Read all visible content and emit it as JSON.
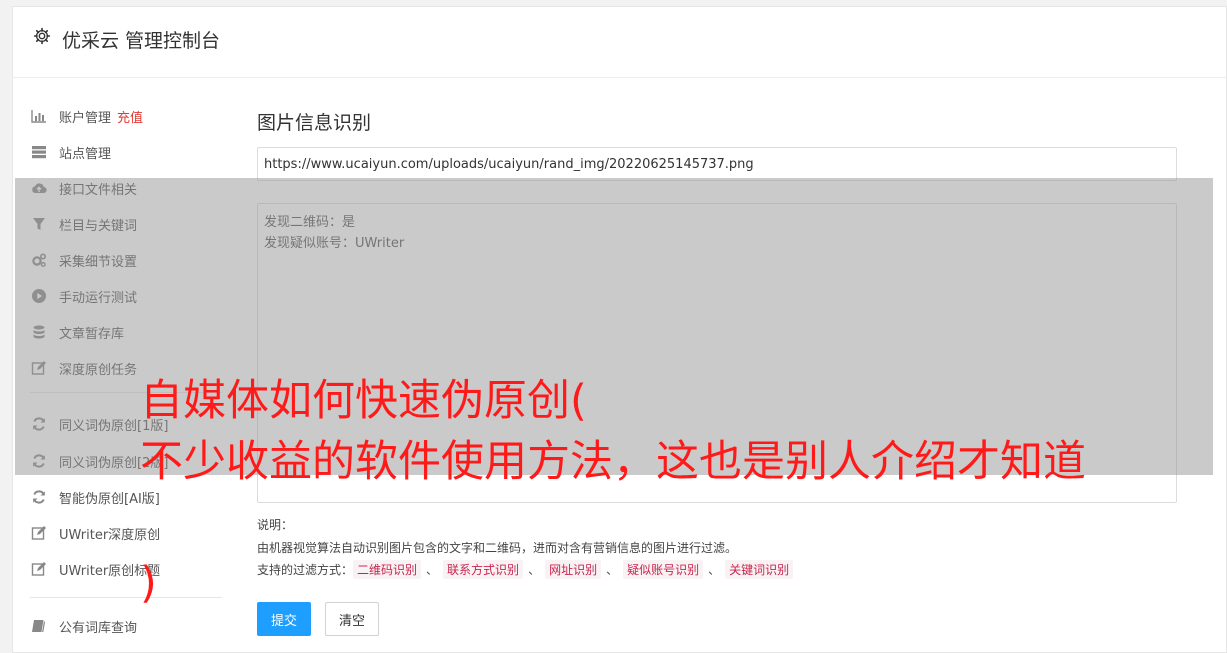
{
  "header": {
    "title": "优采云 管理控制台",
    "icon": "gear-icon"
  },
  "sidebar": {
    "items": [
      {
        "label": "账户管理",
        "badge": "充值",
        "icon": "bar-chart-icon"
      },
      {
        "label": "站点管理",
        "icon": "server-icon"
      },
      {
        "label": "接口文件相关",
        "icon": "cloud-upload-icon"
      },
      {
        "label": "栏目与关键词",
        "icon": "filter-icon"
      },
      {
        "label": "采集细节设置",
        "icon": "cogs-icon"
      },
      {
        "label": "手动运行测试",
        "icon": "play-circle-icon"
      },
      {
        "label": "文章暂存库",
        "icon": "database-icon"
      },
      {
        "label": "深度原创任务",
        "icon": "edit-icon"
      },
      {
        "label": "同义词伪原创[1版]",
        "icon": "refresh-icon"
      },
      {
        "label": "同义词伪原创[2版]",
        "icon": "refresh-icon"
      },
      {
        "label": "智能伪原创[AI版]",
        "icon": "refresh-icon"
      },
      {
        "label": "UWriter深度原创",
        "icon": "edit-icon"
      },
      {
        "label": "UWriter原创标题",
        "icon": "edit-icon"
      },
      {
        "label": "公有词库查询",
        "icon": "book-icon"
      }
    ]
  },
  "main": {
    "title": "图片信息识别",
    "url_value": "https://www.ucaiyun.com/uploads/ucaiyun/rand_img/20220625145737.png",
    "result_lines": [
      "发现二维码：是",
      "发现疑似账号：UWriter"
    ],
    "desc_label": "说明：",
    "desc_text": "由机器视觉算法自动识别图片包含的文字和二维码，进而对含有营销信息的图片进行过滤。",
    "filters_label": "支持的过滤方式：",
    "filters": [
      "二维码识别",
      "联系方式识别",
      "网址识别",
      "疑似账号识别",
      "关键词识别"
    ],
    "filter_separator": "、",
    "submit_label": "提交",
    "clear_label": "清空"
  },
  "overlay": {
    "line1": "自媒体如何快速伪原创(",
    "line2": "不少收益的软件使用方法，这也是别人介绍才知道",
    "line3": ")"
  },
  "colors": {
    "primary": "#1e9fff",
    "accent_red": "#e53935",
    "overlay_text": "#ff1a1a",
    "tag_text": "#c7254e"
  }
}
